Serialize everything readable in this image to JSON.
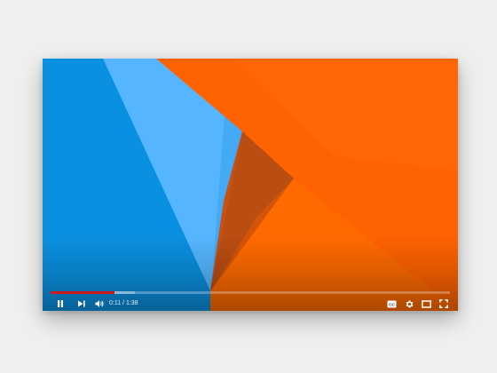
{
  "player": {
    "colors": {
      "progress_played": "#cc181e",
      "icon": "#ffffff",
      "bg_blue": "#0b8fe0",
      "light_blue": "#55b6ff",
      "orange": "#ff6200",
      "dark_orange": "#c65216"
    },
    "progress": {
      "played_fraction": 0.16,
      "loaded_fraction": 0.21
    },
    "time": {
      "current": "0:11",
      "separator": " / ",
      "duration": "1:38"
    },
    "controls_left": [
      "pause-icon",
      "next-icon",
      "volume-icon"
    ],
    "controls_right": [
      "captions-icon",
      "settings-icon",
      "theater-mode-icon",
      "fullscreen-icon"
    ]
  }
}
